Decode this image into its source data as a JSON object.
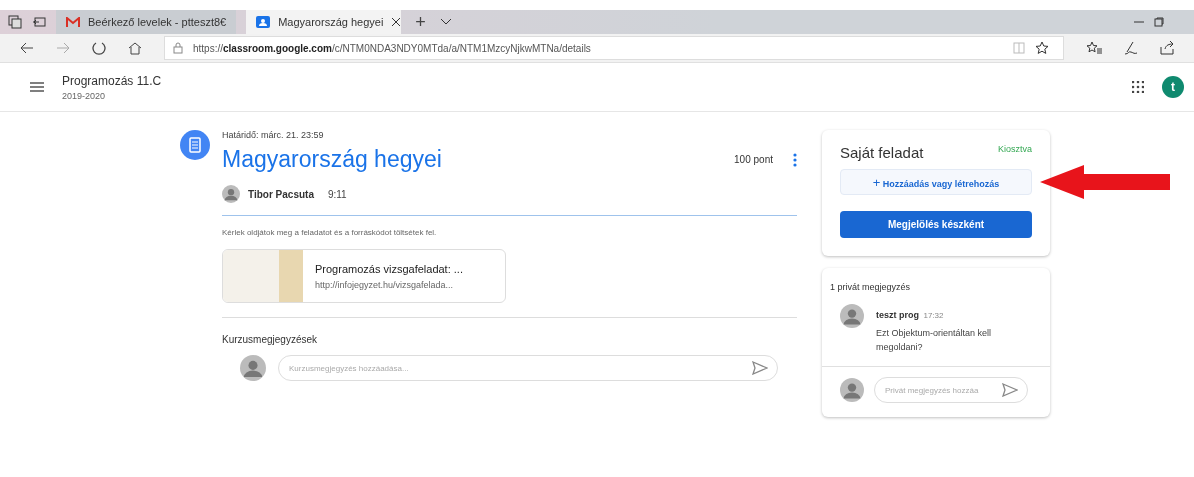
{
  "browser": {
    "tabs": [
      {
        "label": "Beérkező levelek - ptteszt8€",
        "kind": "mail",
        "selected": false
      },
      {
        "label": "Magyarország hegyei",
        "kind": "classroom",
        "selected": true
      }
    ],
    "new_tab": "+",
    "address": {
      "prefix": "https://",
      "host": "classroom.google.com",
      "path": "/c/NTM0NDA3NDY0MTda/a/NTM1MzcyNjkwMTNa/details"
    }
  },
  "header": {
    "class_name": "Programozás 11.C",
    "year": "2019-2020",
    "avatar_letter": "t"
  },
  "assignment": {
    "due": "Határidő: márc. 21. 23:59",
    "title": "Magyarország hegyei",
    "points": "100 pont",
    "author": "Tibor Pacsuta",
    "time": "9:11",
    "description": "Kérlek oldjátok meg a feladatot és a forráskódot töltsétek fel.",
    "attachment": {
      "title": "Programozás vizsgafeladat: ...",
      "url": "http://infojegyzet.hu/vizsgafelada..."
    },
    "comments_heading": "Kurzusmegjegyzések",
    "comment_placeholder": "Kurzusmegjegyzés hozzáadása..."
  },
  "my_work": {
    "title": "Saját feladat",
    "status": "Kiosztva",
    "add_button": "Hozzáadás vagy létrehozás",
    "add_icon": "+",
    "done_button": "Megjelölés készként"
  },
  "private_comments": {
    "heading": "1 privát megjegyzés",
    "comments": [
      {
        "author": "teszt prog",
        "time": "17:32",
        "text": "Ezt Objektum-orientáltan kell megoldani?"
      }
    ],
    "placeholder": "Privát megjegyzés hozzáa"
  }
}
